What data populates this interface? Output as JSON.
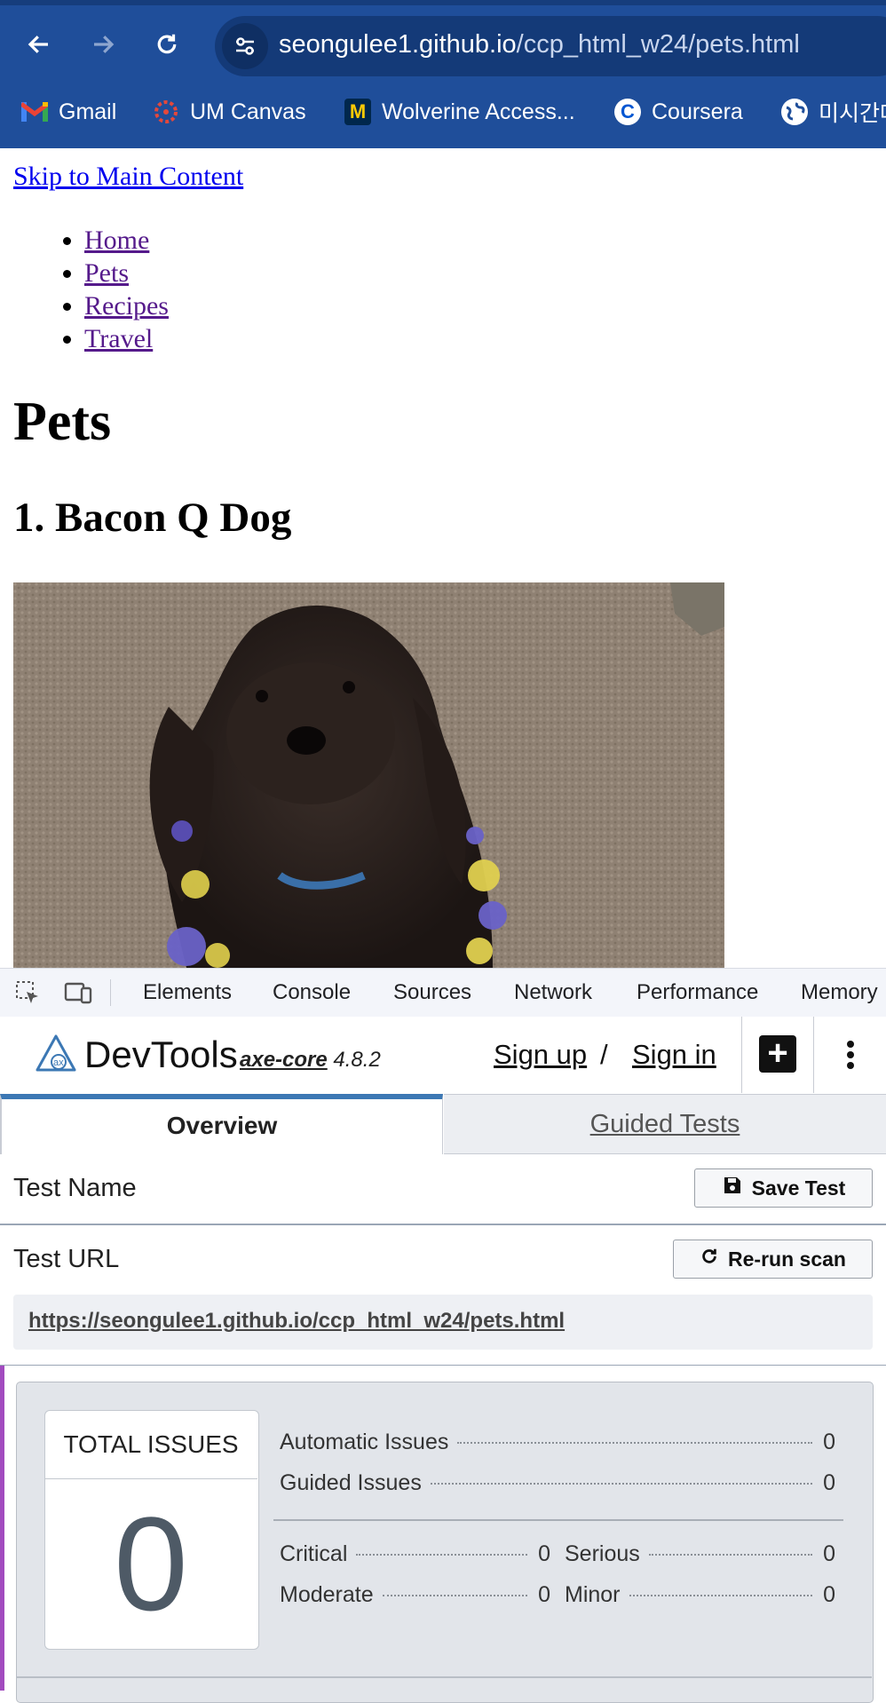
{
  "browser": {
    "url_host": "seongulee1.github.io",
    "url_path": "/ccp_html_w24/pets.html",
    "bookmarks": [
      {
        "label": "Gmail",
        "icon": "gmail-icon"
      },
      {
        "label": "UM Canvas",
        "icon": "canvas-icon"
      },
      {
        "label": "Wolverine Access...",
        "icon": "block-m-icon"
      },
      {
        "label": "Coursera",
        "icon": "coursera-icon"
      },
      {
        "label": "미시간대",
        "icon": "globe-icon"
      }
    ]
  },
  "page": {
    "skip_link": "Skip to Main Content",
    "nav": [
      "Home",
      "Pets",
      "Recipes",
      "Travel"
    ],
    "title": "Pets",
    "pet_heading": "1. Bacon Q Dog"
  },
  "devtools": {
    "tabs": [
      "Elements",
      "Console",
      "Sources",
      "Network",
      "Performance",
      "Memory"
    ]
  },
  "axe": {
    "brand": "DevTools",
    "engine_name": "axe-core",
    "engine_version": "4.8.2",
    "sign_up": "Sign up",
    "slash": "/",
    "sign_in": "Sign in",
    "tab_overview": "Overview",
    "tab_guided": "Guided Tests",
    "test_name_label": "Test Name",
    "save_test": "Save Test",
    "test_url_label": "Test URL",
    "rerun": "Re-run scan",
    "test_url": "https://seongulee1.github.io/ccp_html_w24/pets.html",
    "total_issues_label": "TOTAL ISSUES",
    "total_issues": "0",
    "automatic_label": "Automatic Issues",
    "automatic": "0",
    "guided_label": "Guided Issues",
    "guided": "0",
    "critical_label": "Critical",
    "critical": "0",
    "serious_label": "Serious",
    "serious": "0",
    "moderate_label": "Moderate",
    "moderate": "0",
    "minor_label": "Minor",
    "minor": "0"
  },
  "colors": {
    "chrome": "#1f4e9a",
    "accent_tab": "#3c78b4",
    "purple_bar": "#a24bbf"
  }
}
